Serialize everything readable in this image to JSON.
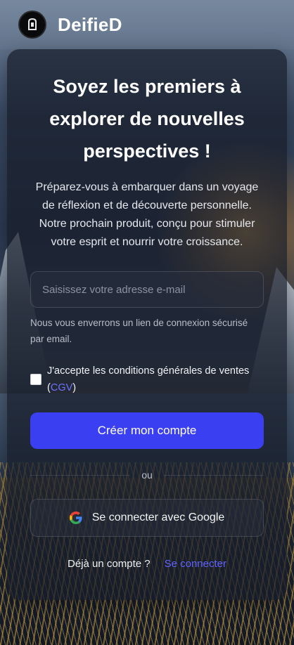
{
  "header": {
    "brand": "DeifieD",
    "logo_icon": "logo-icon"
  },
  "card": {
    "title": "Soyez les premiers à explorer de nouvelles perspectives !",
    "description": "Préparez-vous à embarquer dans un voyage de réflexion et de découverte personnelle. Notre prochain produit, conçu pour stimuler votre esprit et nourrir votre croissance.",
    "email_placeholder": "Saisissez votre adresse e-mail",
    "email_value": "",
    "hint": "Nous vous enverrons un lien de connexion sécurisé par email.",
    "terms_prefix": "J'accepte les conditions générales de ventes (",
    "terms_link": "CGV",
    "terms_suffix": ")",
    "terms_checked": false,
    "submit_label": "Créer mon compte",
    "divider_label": "ou",
    "google_label": "Se connecter avec Google",
    "google_icon": "google-icon",
    "login_question": "Déjà un compte ?",
    "login_link": "Se connecter"
  },
  "colors": {
    "accent": "#3b3ff2",
    "link": "#5f63ff"
  }
}
